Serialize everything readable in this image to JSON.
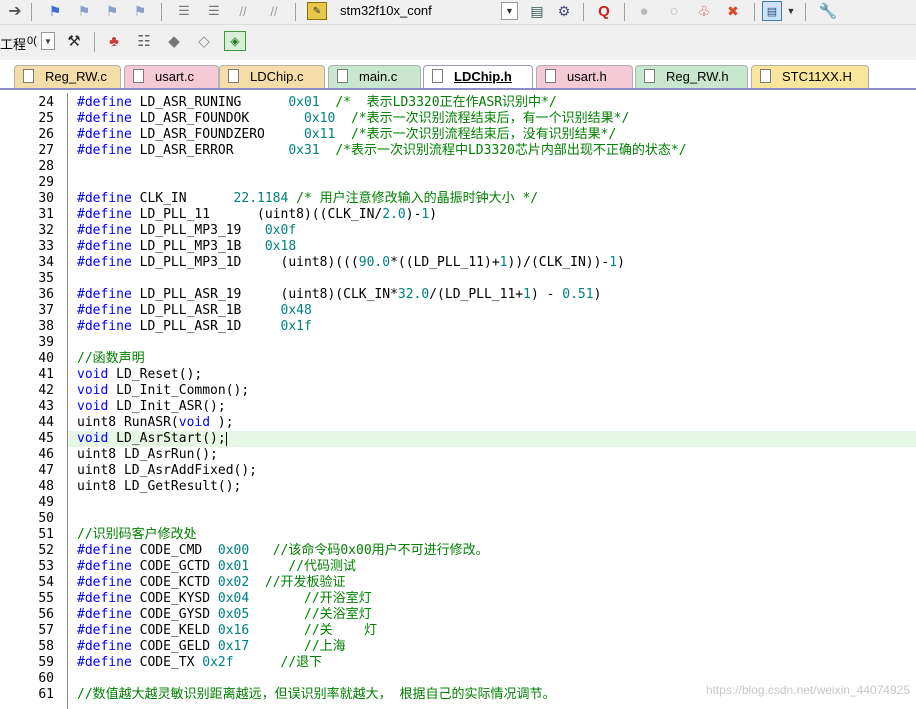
{
  "toolbar": {
    "target_name": "stm32f10x_conf",
    "project_label": "工程",
    "project_combo": "0("
  },
  "tabs": [
    {
      "label": "Reg_RW.c",
      "color": "#f5ddaa",
      "active": false
    },
    {
      "label": "usart.c",
      "color": "#f5c9d6",
      "active": false
    },
    {
      "label": "LDChip.c",
      "color": "#f5ddaa",
      "active": false
    },
    {
      "label": "main.c",
      "color": "#c9e7cf",
      "active": false
    },
    {
      "label": "LDChip.h",
      "color": "#ffffff",
      "active": true
    },
    {
      "label": "usart.h",
      "color": "#f5c9d6",
      "active": false
    },
    {
      "label": "Reg_RW.h",
      "color": "#c9e7cf",
      "active": false
    },
    {
      "label": "STC11XX.H",
      "color": "#f9e69a",
      "active": false
    }
  ],
  "editor": {
    "line_numbers": [
      "24",
      "25",
      "26",
      "27",
      "28",
      "29",
      "30",
      "31",
      "32",
      "33",
      "34",
      "35",
      "36",
      "37",
      "38",
      "39",
      "40",
      "41",
      "42",
      "43",
      "44",
      "45",
      "46",
      "47",
      "48",
      "49",
      "50",
      "51",
      "52",
      "53",
      "54",
      "55",
      "56",
      "57",
      "58",
      "59",
      "60",
      "61"
    ],
    "current_line": "45",
    "lines": [
      {
        "segs": [
          [
            "k",
            "#define"
          ],
          [
            "",
            "LD_ASR_RUNING      "
          ],
          [
            "n",
            "0x01"
          ],
          [
            "",
            "  "
          ],
          [
            "c",
            "/*  表示LD3320正在作ASR识别中*/"
          ]
        ]
      },
      {
        "segs": [
          [
            "k",
            "#define"
          ],
          [
            "",
            "LD_ASR_FOUNDOK       "
          ],
          [
            "n",
            "0x10"
          ],
          [
            "",
            "  "
          ],
          [
            "c",
            "/*表示一次识别流程结束后，有一个识别结果*/"
          ]
        ]
      },
      {
        "segs": [
          [
            "k",
            "#define"
          ],
          [
            "",
            "LD_ASR_FOUNDZERO     "
          ],
          [
            "n",
            "0x11"
          ],
          [
            "",
            "  "
          ],
          [
            "c",
            "/*表示一次识别流程结束后，没有识别结果*/"
          ]
        ]
      },
      {
        "segs": [
          [
            "k",
            "#define"
          ],
          [
            "",
            "LD_ASR_ERROR       "
          ],
          [
            "n",
            "0x31"
          ],
          [
            "",
            "  "
          ],
          [
            "c",
            "/*表示一次识别流程中LD3320芯片内部出现不正确的状态*/"
          ]
        ]
      },
      {
        "segs": []
      },
      {
        "segs": []
      },
      {
        "segs": [
          [
            "k",
            "#define"
          ],
          [
            "",
            "CLK_IN      "
          ],
          [
            "n",
            "22.1184"
          ],
          [
            "",
            ""
          ],
          [
            "c",
            " /* 用户注意修改输入的晶振时钟大小 */"
          ]
        ]
      },
      {
        "segs": [
          [
            "k",
            "#define"
          ],
          [
            "",
            "LD_PLL_11      (uint8)((CLK_IN/"
          ],
          [
            "n",
            "2.0"
          ],
          [
            "",
            ")-"
          ],
          [
            "n",
            "1"
          ],
          [
            "",
            ")"
          ]
        ]
      },
      {
        "segs": [
          [
            "k",
            "#define"
          ],
          [
            "",
            "LD_PLL_MP3_19   "
          ],
          [
            "n",
            "0x0f"
          ]
        ]
      },
      {
        "segs": [
          [
            "k",
            "#define"
          ],
          [
            "",
            "LD_PLL_MP3_1B   "
          ],
          [
            "n",
            "0x18"
          ]
        ]
      },
      {
        "segs": [
          [
            "k",
            "#define"
          ],
          [
            "",
            "LD_PLL_MP3_1D     (uint8)((("
          ],
          [
            "n",
            "90.0"
          ],
          [
            "",
            "*((LD_PLL_11)+"
          ],
          [
            "n",
            "1"
          ],
          [
            "",
            "))/(CLK_IN))-"
          ],
          [
            "n",
            "1"
          ],
          [
            "",
            ")"
          ]
        ]
      },
      {
        "segs": []
      },
      {
        "segs": [
          [
            "k",
            "#define"
          ],
          [
            "",
            "LD_PLL_ASR_19     (uint8)(CLK_IN*"
          ],
          [
            "n",
            "32.0"
          ],
          [
            "",
            "/(LD_PLL_11+"
          ],
          [
            "n",
            "1"
          ],
          [
            "",
            ") - "
          ],
          [
            "n",
            "0.51"
          ],
          [
            "",
            ")"
          ]
        ]
      },
      {
        "segs": [
          [
            "k",
            "#define"
          ],
          [
            "",
            "LD_PLL_ASR_1B     "
          ],
          [
            "n",
            "0x48"
          ]
        ]
      },
      {
        "segs": [
          [
            "k",
            "#define"
          ],
          [
            "",
            "LD_PLL_ASR_1D     "
          ],
          [
            "n",
            "0x1f"
          ]
        ]
      },
      {
        "segs": []
      },
      {
        "segs": [
          [
            "c",
            "//函数声明"
          ]
        ]
      },
      {
        "segs": [
          [
            "k",
            "void"
          ],
          [
            "",
            "LD_Reset();"
          ]
        ]
      },
      {
        "segs": [
          [
            "k",
            "void"
          ],
          [
            "",
            "LD_Init_Common();"
          ]
        ]
      },
      {
        "segs": [
          [
            "k",
            "void"
          ],
          [
            "",
            "LD_Init_ASR();"
          ]
        ]
      },
      {
        "segs": [
          [
            "",
            "uint8 RunASR("
          ],
          [
            "k",
            "void"
          ],
          [
            "",
            ");"
          ]
        ]
      },
      {
        "segs": [
          [
            "k",
            "void"
          ],
          [
            "",
            "LD_AsrStart();"
          ]
        ]
      },
      {
        "segs": [
          [
            "",
            "uint8 LD_AsrRun();"
          ]
        ]
      },
      {
        "segs": [
          [
            "",
            "uint8 LD_AsrAddFixed();"
          ]
        ]
      },
      {
        "segs": [
          [
            "",
            "uint8 LD_GetResult();"
          ]
        ]
      },
      {
        "segs": []
      },
      {
        "segs": []
      },
      {
        "segs": [
          [
            "c",
            "//识别码客户修改处"
          ]
        ]
      },
      {
        "segs": [
          [
            "k",
            "#define"
          ],
          [
            "",
            "CODE_CMD  "
          ],
          [
            "n",
            "0x00"
          ],
          [
            "",
            "   "
          ],
          [
            "c",
            "//该命令码0x00用户不可进行修改。"
          ]
        ]
      },
      {
        "segs": [
          [
            "k",
            "#define"
          ],
          [
            "",
            "CODE_GCTD "
          ],
          [
            "n",
            "0x01"
          ],
          [
            "",
            "     "
          ],
          [
            "c",
            "//代码测试"
          ]
        ]
      },
      {
        "segs": [
          [
            "k",
            "#define"
          ],
          [
            "",
            "CODE_KCTD "
          ],
          [
            "n",
            "0x02"
          ],
          [
            "",
            "  "
          ],
          [
            "c",
            "//开发板验证"
          ]
        ]
      },
      {
        "segs": [
          [
            "k",
            "#define"
          ],
          [
            "",
            "CODE_KYSD "
          ],
          [
            "n",
            "0x04"
          ],
          [
            "",
            "       "
          ],
          [
            "c",
            "//开浴室灯"
          ]
        ]
      },
      {
        "segs": [
          [
            "k",
            "#define"
          ],
          [
            "",
            "CODE_GYSD "
          ],
          [
            "n",
            "0x05"
          ],
          [
            "",
            "       "
          ],
          [
            "c",
            "//关浴室灯"
          ]
        ]
      },
      {
        "segs": [
          [
            "k",
            "#define"
          ],
          [
            "",
            "CODE_KELD "
          ],
          [
            "n",
            "0x16"
          ],
          [
            "",
            "       "
          ],
          [
            "c",
            "//关    灯"
          ]
        ]
      },
      {
        "segs": [
          [
            "k",
            "#define"
          ],
          [
            "",
            "CODE_GELD "
          ],
          [
            "n",
            "0x17"
          ],
          [
            "",
            "       "
          ],
          [
            "c",
            "//上海"
          ]
        ]
      },
      {
        "segs": [
          [
            "k",
            "#define"
          ],
          [
            "",
            "CODE_TX "
          ],
          [
            "n",
            "0x2f"
          ],
          [
            "",
            "      "
          ],
          [
            "c",
            "//退下"
          ]
        ]
      },
      {
        "segs": []
      },
      {
        "segs": [
          [
            "c",
            "//数值越大越灵敏识别距离越远，但误识别率就越大， 根据自己的实际情况调节。"
          ]
        ]
      }
    ]
  },
  "watermark": "https://blog.csdn.net/weixin_44074925"
}
